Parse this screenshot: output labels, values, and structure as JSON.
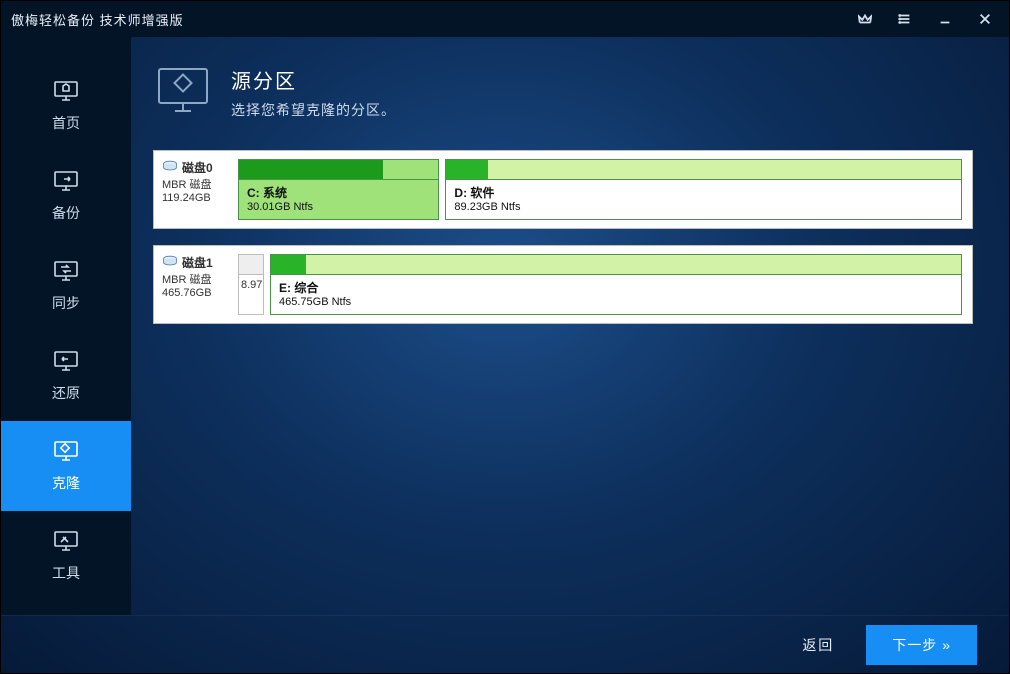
{
  "title": "傲梅轻松备份 技术师增强版",
  "sidebar": {
    "items": [
      {
        "label": "首页"
      },
      {
        "label": "备份"
      },
      {
        "label": "同步"
      },
      {
        "label": "还原"
      },
      {
        "label": "克隆"
      },
      {
        "label": "工具"
      }
    ]
  },
  "header": {
    "heading": "源分区",
    "sub": "选择您希望克隆的分区。"
  },
  "disks": [
    {
      "name": "磁盘0",
      "type": "MBR 磁盘",
      "size": "119.24GB",
      "small": null,
      "parts": [
        {
          "title": "C: 系统",
          "detail": "30.01GB Ntfs",
          "flex": 155,
          "fill": 72,
          "selected": true
        },
        {
          "title": "D: 软件",
          "detail": "89.23GB Ntfs",
          "flex": 400,
          "fill": 8,
          "selected": false
        }
      ]
    },
    {
      "name": "磁盘1",
      "type": "MBR 磁盘",
      "size": "465.76GB",
      "small": "8.97",
      "parts": [
        {
          "title": "E: 综合",
          "detail": "465.75GB Ntfs",
          "flex": 1,
          "fill": 5,
          "selected": false
        }
      ]
    }
  ],
  "footer": {
    "back": "返回",
    "next": "下一步 »"
  }
}
